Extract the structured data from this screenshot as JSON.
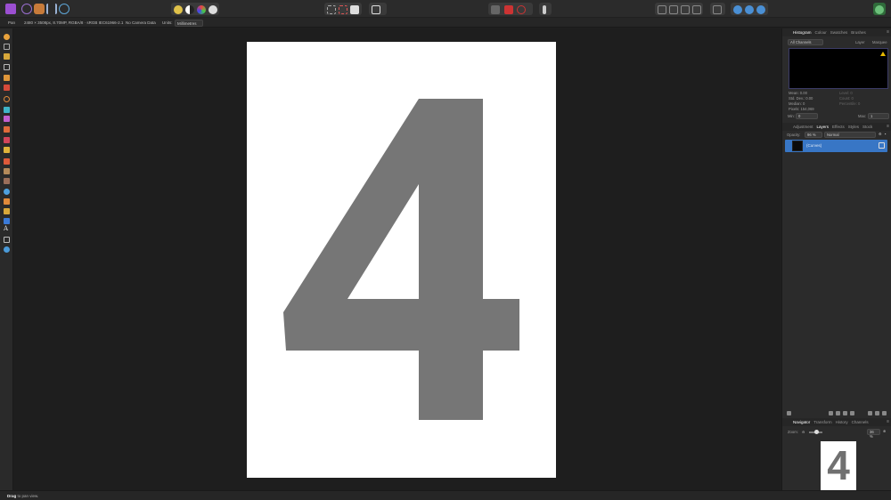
{
  "toolbar": {
    "personas": [
      "photo-persona-icon",
      "liquify-persona-icon",
      "develop-persona-icon",
      "tone-mapping-persona-icon",
      "export-persona-icon"
    ],
    "help_icon": "user-icon"
  },
  "context": {
    "pan_label": "Pan",
    "doc_info": "2480 × 3508px, 8.70MP, RGBA/8 · sRGB IEC61966-2.1",
    "camera_info": "No Camera Data",
    "units_label": "Units:",
    "units_value": "Millimetres"
  },
  "canvas": {
    "glyph": "4",
    "page_color": "#ffffff",
    "glyph_color": "#767676"
  },
  "histogram_panel": {
    "tabs": [
      "Histogram",
      "Colour",
      "Swatches",
      "Brushes"
    ],
    "active_tab": "Histogram",
    "channel": "All Channels",
    "layer_toggle": "Layer",
    "marquee_toggle": "Marquee",
    "stats_left": [
      "Mean: 0.00",
      "Std. Dev.: 0.00",
      "Median: 0",
      "Pixels: 154,069"
    ],
    "stats_right": [
      "Level: 0",
      "Count: 0",
      "Percentile: 0"
    ],
    "min_label": "Min:",
    "min_value": "0",
    "max_label": "Max:",
    "max_value": "1"
  },
  "layers_panel": {
    "tabs": [
      "Adjustment",
      "Layers",
      "Effects",
      "Styles",
      "Stock"
    ],
    "active_tab": "Layers",
    "opacity_label": "Opacity:",
    "opacity_value": "96 %",
    "blend_mode": "Normal",
    "layer_name": "(Curves)"
  },
  "navigator_panel": {
    "tabs": [
      "Navigator",
      "Transform",
      "History",
      "Channels"
    ],
    "active_tab": "Navigator",
    "zoom_label": "Zoom:",
    "zoom_value": "36 %",
    "zoom_level": 0.36
  },
  "status": {
    "tool": "Drag",
    "hint": "to pan view."
  }
}
